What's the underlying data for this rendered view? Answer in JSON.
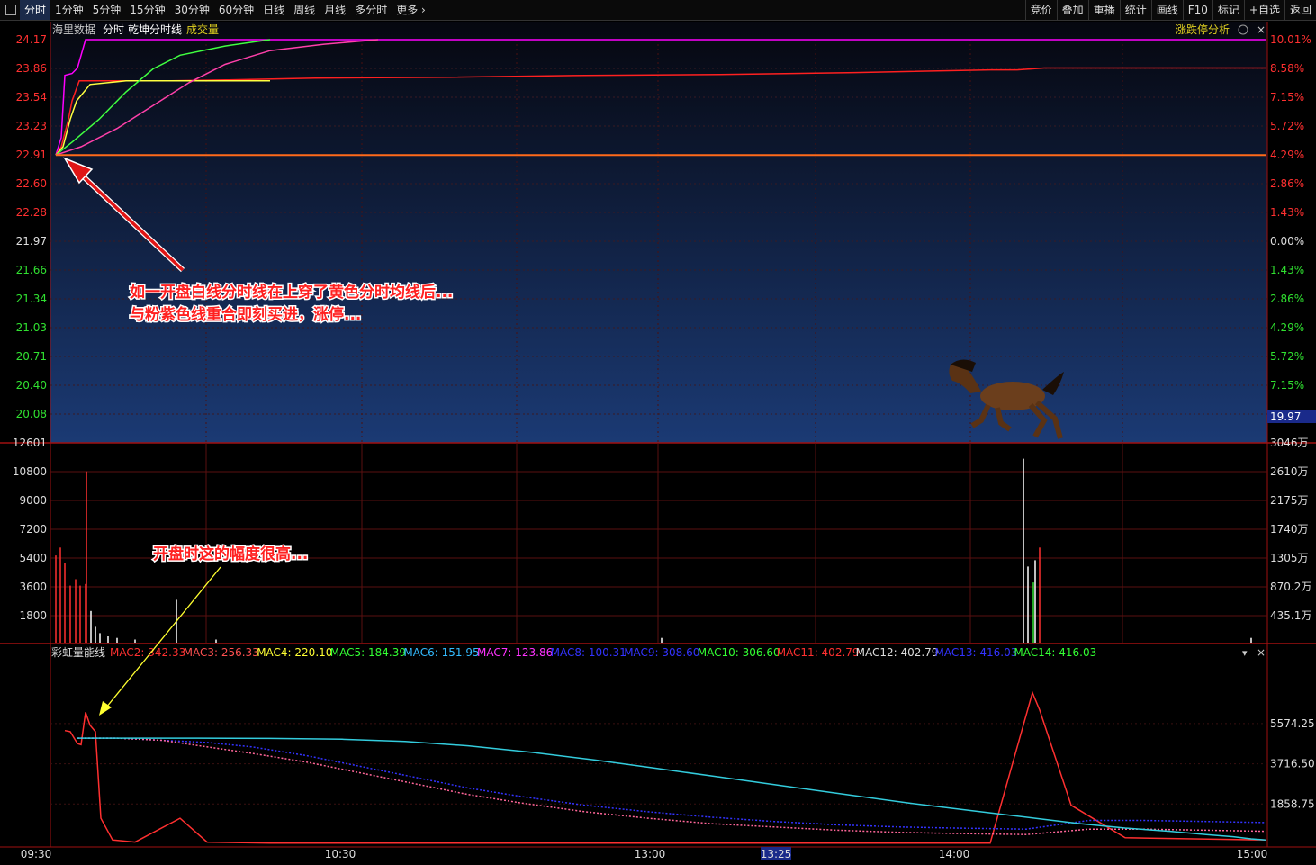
{
  "toolbar": {
    "left": [
      "分时",
      "1分钟",
      "5分钟",
      "15分钟",
      "30分钟",
      "60分钟",
      "日线",
      "周线",
      "月线",
      "多分时",
      "更多"
    ],
    "right": [
      "竞价",
      "叠加",
      "重播",
      "统计",
      "画线",
      "F10",
      "标记",
      "+自选",
      "返回"
    ]
  },
  "header": {
    "source": "海里数据",
    "mode": "分时",
    "indicator": "乾坤分时线",
    "volume_label": "成交量",
    "right_label": "涨跌停分析"
  },
  "price_axis_left": [
    "24.17",
    "23.86",
    "23.54",
    "23.23",
    "22.91",
    "22.60",
    "22.28",
    "21.97",
    "21.66",
    "21.34",
    "21.03",
    "20.71",
    "20.40",
    "20.08"
  ],
  "price_axis_right": [
    "10.01%",
    "8.58%",
    "7.15%",
    "5.72%",
    "4.29%",
    "2.86%",
    "1.43%",
    "0.00%",
    "1.43%",
    "2.86%",
    "4.29%",
    "5.72%",
    "7.15%"
  ],
  "limit_down_price": "19.97",
  "volume_axis_left": [
    "12601",
    "10800",
    "9000",
    "7200",
    "5400",
    "3600",
    "1800"
  ],
  "volume_axis_right": [
    "3046万",
    "2610万",
    "2175万",
    "1740万",
    "1305万",
    "870.2万",
    "435.1万"
  ],
  "indicator_panel": {
    "name": "彩虹量能线",
    "legend": [
      {
        "label": "MAC2: 342.33",
        "color": "#ff3030"
      },
      {
        "label": "MAC3: 256.33",
        "color": "#ff5050"
      },
      {
        "label": "MAC4: 220.10",
        "color": "#ffff33"
      },
      {
        "label": "MAC5: 184.39",
        "color": "#33ff33"
      },
      {
        "label": "MAC6: 151.95",
        "color": "#33bbff"
      },
      {
        "label": "MAC7: 123.86",
        "color": "#ff33ff"
      },
      {
        "label": "MAC8: 100.31",
        "color": "#3333ff"
      },
      {
        "label": "MAC9: 308.60",
        "color": "#3333ff"
      },
      {
        "label": "MAC10: 306.60",
        "color": "#33ff33"
      },
      {
        "label": "MAC11: 402.79",
        "color": "#ff3030"
      },
      {
        "label": "MAC12: 402.79",
        "color": "#dddddd"
      },
      {
        "label": "MAC13: 416.03",
        "color": "#3333ff"
      },
      {
        "label": "MAC14: 416.03",
        "color": "#33ff33"
      }
    ],
    "axis_right": [
      "5574.25",
      "3716.50",
      "1858.75"
    ]
  },
  "time_axis": [
    "09:30",
    "10:30",
    "13:00",
    "13:25",
    "14:00",
    "15:00"
  ],
  "annotations": {
    "main_line1": "如一开盘白线分时线在上穿了黄色分时均线后...",
    "main_line2": "与粉紫色线重合即刻买进，涨停...",
    "volume_note": "开盘时这的幅度很高..."
  },
  "chart_data": [
    {
      "type": "line",
      "series": [
        {
          "values": [
            22.91,
            23.1,
            23.78,
            23.8,
            23.86,
            24.17,
            24.17,
            24.17,
            24.17,
            24.17,
            24.17,
            24.17,
            24.17,
            24.17
          ],
          "color": "#ff00ff"
        },
        {
          "values": [
            22.91,
            23.0,
            23.3,
            23.5,
            23.72,
            23.72,
            23.72,
            23.73,
            23.75,
            23.76,
            23.78,
            23.79,
            23.81,
            23.84,
            23.84,
            23.86,
            23.86,
            23.86,
            23.86
          ],
          "color": "#ff2020"
        },
        {
          "values": [
            22.91,
            23.0,
            23.3,
            23.5,
            23.68,
            23.72,
            23.72,
            23.72
          ],
          "color": "#ffff40"
        },
        {
          "values": [
            22.91,
            23.05,
            23.3,
            23.6,
            23.85,
            24.0,
            24.1,
            24.17
          ],
          "color": "#40ff40"
        },
        {
          "values": [
            22.91,
            23.0,
            23.2,
            23.45,
            23.7,
            23.9,
            24.05,
            24.12,
            24.17
          ],
          "color": "#ff40aa"
        },
        {
          "values": [
            22.91,
            22.91
          ],
          "color": "#ff6a1a"
        }
      ],
      "ylim": [
        20.08,
        24.17
      ]
    },
    {
      "type": "bar",
      "series": [
        {
          "values": [
            5500,
            6000,
            5000,
            3600,
            4000,
            3600,
            3700,
            10800,
            2000,
            1000,
            600,
            400,
            300,
            200,
            2700,
            200,
            300,
            11600,
            4800,
            3800,
            5200,
            6000,
            300
          ],
          "color": "#ff3030"
        }
      ],
      "ylim": [
        0,
        12601
      ]
    },
    {
      "type": "line",
      "series": [
        {
          "name": "MAC2",
          "values": [
            5250,
            5200,
            4650,
            4600,
            6100,
            5500,
            5200,
            1200,
            200,
            100,
            1200,
            100,
            50,
            50,
            7000,
            6200,
            1800,
            300,
            200
          ],
          "color": "#ff3030"
        },
        {
          "name": "MAC13",
          "values": [
            4900,
            4900,
            4900,
            4800,
            4700,
            4500,
            4100,
            3600,
            3100,
            2600,
            2200,
            1800,
            1500,
            1250,
            1050,
            900,
            800,
            750,
            700,
            1100,
            1100,
            1050,
            1000
          ],
          "color": "#3333ff"
        },
        {
          "name": "MAC12",
          "values": [
            4900,
            4900,
            4900,
            4800,
            4500,
            4200,
            3800,
            3300,
            2800,
            2300,
            1900,
            1500,
            1200,
            950,
            800,
            650,
            550,
            500,
            450,
            700,
            700,
            650,
            600
          ],
          "color": "#ff6699"
        },
        {
          "name": "MAC14",
          "values": [
            4900,
            4900,
            4900,
            4890,
            4850,
            4750,
            4550,
            4250,
            3900,
            3500,
            3100,
            2700,
            2300,
            1900,
            1550,
            1200,
            950,
            750,
            600,
            450,
            350,
            250,
            200
          ],
          "color": "#33ccdd"
        }
      ],
      "ylim": [
        0,
        7400
      ]
    }
  ]
}
